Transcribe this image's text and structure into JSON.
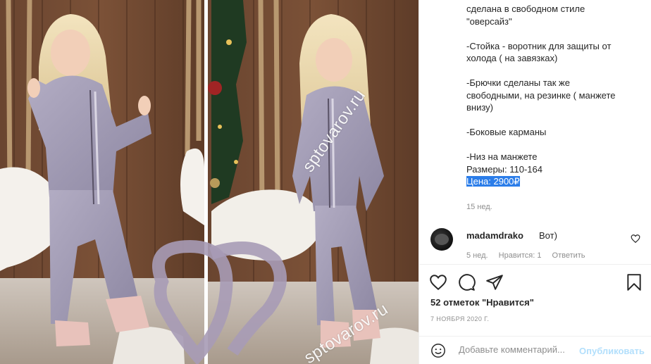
{
  "photo": {
    "watermark_top": "sptovarov.ru",
    "watermark_bottom": "sptovarov.ru"
  },
  "caption": {
    "lines_a": [
      "сделана в свободном стиле",
      "\"оверсайз\""
    ],
    "lines_b": [
      "-Стойка - воротник для защиты от",
      "холода ( на завязках)"
    ],
    "lines_c": [
      "-Брючки сделаны так же",
      "свободными, на резинке ( манжете",
      "внизу)"
    ],
    "line_d": "-Боковые карманы",
    "line_e": "-Низ на манжете",
    "sizes": "Размеры: 110-164",
    "price": "Цена: 2900₽",
    "time": "15 нед."
  },
  "comment": {
    "username": "madamdrako",
    "text": "Вот)",
    "time": "5 нед.",
    "likes": "Нравится: 1",
    "reply": "Ответить"
  },
  "actions": {
    "icons": [
      "heart-icon",
      "comment-icon",
      "share-icon",
      "bookmark-icon"
    ]
  },
  "likes_text": "52 отметок \"Нравится\"",
  "date": "7 НОЯБРЯ 2020 Г.",
  "add_comment": {
    "placeholder": "Добавьте комментарий...",
    "publish": "Опубликовать"
  },
  "colors": {
    "selection_highlight": "#2b7de9",
    "publish_disabled": "#b2dffc",
    "text_primary": "#262626",
    "text_secondary": "#8e8e8e"
  }
}
